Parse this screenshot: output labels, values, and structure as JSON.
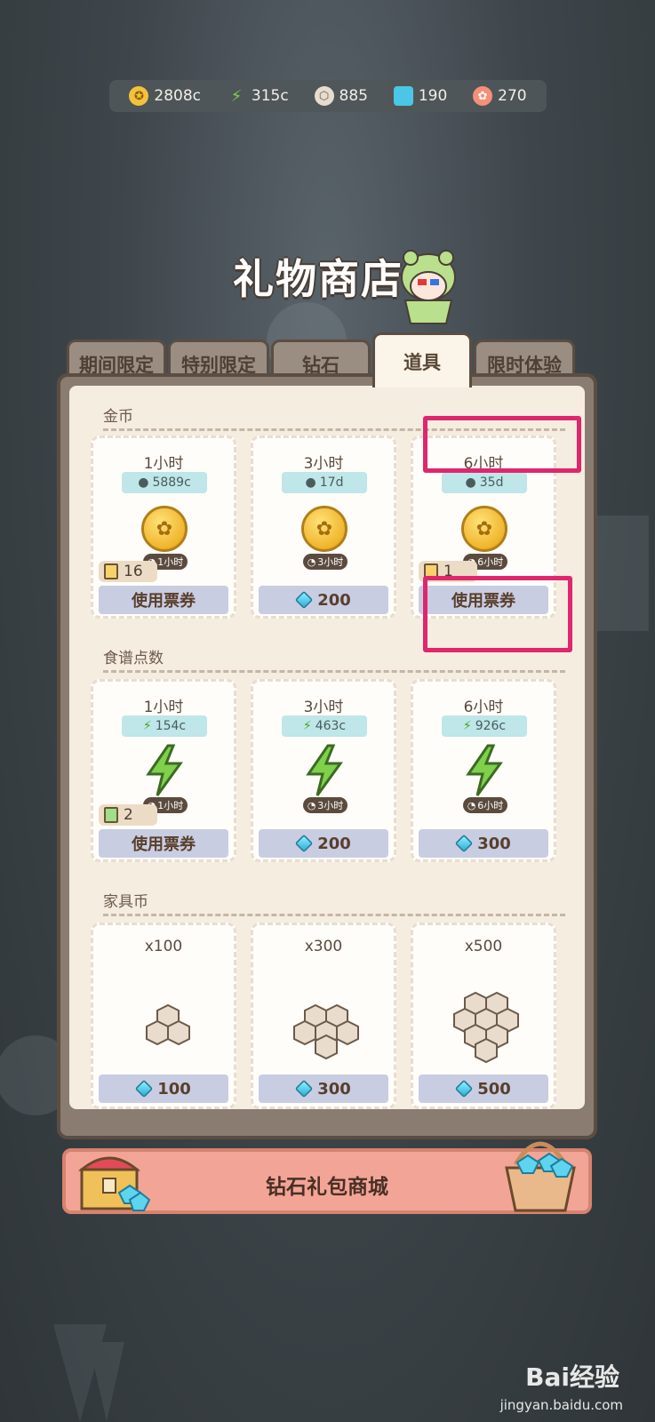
{
  "currencies": [
    {
      "icon": "coin-icon",
      "value": "2808c",
      "color": "#f4c23a"
    },
    {
      "icon": "energy-icon",
      "value": "315c",
      "color": "#7fd04a"
    },
    {
      "icon": "furniture-coin-icon",
      "value": "885",
      "color": "#e6dcd0"
    },
    {
      "icon": "diamond-icon",
      "value": "190",
      "color": "#4cc6e6"
    },
    {
      "icon": "pink-token-icon",
      "value": "270",
      "color": "#f59078"
    }
  ],
  "shop": {
    "title": "礼物商店",
    "tabs": [
      "期间限定",
      "特别限定",
      "钻石",
      "道具",
      "限时体验"
    ],
    "active_tab": "道具"
  },
  "sections": {
    "gold": {
      "label": "金币",
      "cards": [
        {
          "title": "1小时",
          "amount": "5889c",
          "duration": "1小时",
          "tickets": "16",
          "button": "使用票券"
        },
        {
          "title": "3小时",
          "amount": "17d",
          "duration": "3小时",
          "button": "200"
        },
        {
          "title": "6小时",
          "amount": "35d",
          "duration": "6小时",
          "tickets": "1",
          "button": "使用票券"
        }
      ]
    },
    "recipe": {
      "label": "食谱点数",
      "cards": [
        {
          "title": "1小时",
          "amount": "154c",
          "duration": "1小时",
          "tickets": "2",
          "button": "使用票券"
        },
        {
          "title": "3小时",
          "amount": "463c",
          "duration": "3小时",
          "button": "200"
        },
        {
          "title": "6小时",
          "amount": "926c",
          "duration": "6小时",
          "button": "300"
        }
      ]
    },
    "furniture": {
      "label": "家具币",
      "cards": [
        {
          "title": "x100",
          "button": "100"
        },
        {
          "title": "x300",
          "button": "300"
        },
        {
          "title": "x500",
          "button": "500"
        }
      ]
    }
  },
  "banner": {
    "label": "钻石礼包商城"
  },
  "watermark": {
    "brand": "Bai经验",
    "url": "jingyan.baidu.com"
  },
  "highlight_color": "#e0266d"
}
